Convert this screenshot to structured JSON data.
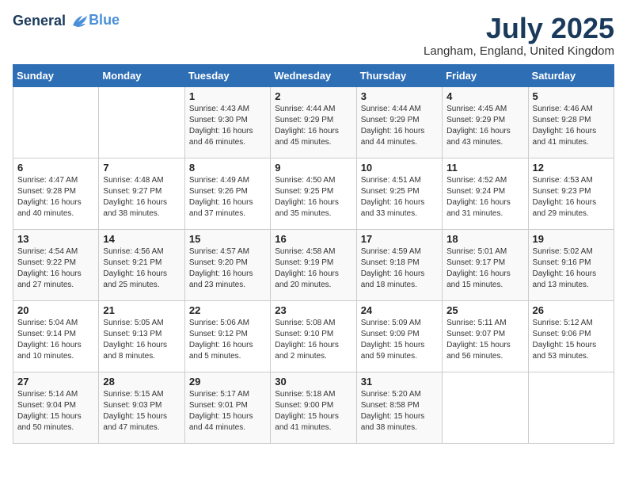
{
  "header": {
    "logo_line1": "General",
    "logo_line2": "Blue",
    "month": "July 2025",
    "location": "Langham, England, United Kingdom"
  },
  "days_of_week": [
    "Sunday",
    "Monday",
    "Tuesday",
    "Wednesday",
    "Thursday",
    "Friday",
    "Saturday"
  ],
  "weeks": [
    [
      {
        "day": "",
        "sunrise": "",
        "sunset": "",
        "daylight": ""
      },
      {
        "day": "",
        "sunrise": "",
        "sunset": "",
        "daylight": ""
      },
      {
        "day": "1",
        "sunrise": "Sunrise: 4:43 AM",
        "sunset": "Sunset: 9:30 PM",
        "daylight": "Daylight: 16 hours and 46 minutes."
      },
      {
        "day": "2",
        "sunrise": "Sunrise: 4:44 AM",
        "sunset": "Sunset: 9:29 PM",
        "daylight": "Daylight: 16 hours and 45 minutes."
      },
      {
        "day": "3",
        "sunrise": "Sunrise: 4:44 AM",
        "sunset": "Sunset: 9:29 PM",
        "daylight": "Daylight: 16 hours and 44 minutes."
      },
      {
        "day": "4",
        "sunrise": "Sunrise: 4:45 AM",
        "sunset": "Sunset: 9:29 PM",
        "daylight": "Daylight: 16 hours and 43 minutes."
      },
      {
        "day": "5",
        "sunrise": "Sunrise: 4:46 AM",
        "sunset": "Sunset: 9:28 PM",
        "daylight": "Daylight: 16 hours and 41 minutes."
      }
    ],
    [
      {
        "day": "6",
        "sunrise": "Sunrise: 4:47 AM",
        "sunset": "Sunset: 9:28 PM",
        "daylight": "Daylight: 16 hours and 40 minutes."
      },
      {
        "day": "7",
        "sunrise": "Sunrise: 4:48 AM",
        "sunset": "Sunset: 9:27 PM",
        "daylight": "Daylight: 16 hours and 38 minutes."
      },
      {
        "day": "8",
        "sunrise": "Sunrise: 4:49 AM",
        "sunset": "Sunset: 9:26 PM",
        "daylight": "Daylight: 16 hours and 37 minutes."
      },
      {
        "day": "9",
        "sunrise": "Sunrise: 4:50 AM",
        "sunset": "Sunset: 9:25 PM",
        "daylight": "Daylight: 16 hours and 35 minutes."
      },
      {
        "day": "10",
        "sunrise": "Sunrise: 4:51 AM",
        "sunset": "Sunset: 9:25 PM",
        "daylight": "Daylight: 16 hours and 33 minutes."
      },
      {
        "day": "11",
        "sunrise": "Sunrise: 4:52 AM",
        "sunset": "Sunset: 9:24 PM",
        "daylight": "Daylight: 16 hours and 31 minutes."
      },
      {
        "day": "12",
        "sunrise": "Sunrise: 4:53 AM",
        "sunset": "Sunset: 9:23 PM",
        "daylight": "Daylight: 16 hours and 29 minutes."
      }
    ],
    [
      {
        "day": "13",
        "sunrise": "Sunrise: 4:54 AM",
        "sunset": "Sunset: 9:22 PM",
        "daylight": "Daylight: 16 hours and 27 minutes."
      },
      {
        "day": "14",
        "sunrise": "Sunrise: 4:56 AM",
        "sunset": "Sunset: 9:21 PM",
        "daylight": "Daylight: 16 hours and 25 minutes."
      },
      {
        "day": "15",
        "sunrise": "Sunrise: 4:57 AM",
        "sunset": "Sunset: 9:20 PM",
        "daylight": "Daylight: 16 hours and 23 minutes."
      },
      {
        "day": "16",
        "sunrise": "Sunrise: 4:58 AM",
        "sunset": "Sunset: 9:19 PM",
        "daylight": "Daylight: 16 hours and 20 minutes."
      },
      {
        "day": "17",
        "sunrise": "Sunrise: 4:59 AM",
        "sunset": "Sunset: 9:18 PM",
        "daylight": "Daylight: 16 hours and 18 minutes."
      },
      {
        "day": "18",
        "sunrise": "Sunrise: 5:01 AM",
        "sunset": "Sunset: 9:17 PM",
        "daylight": "Daylight: 16 hours and 15 minutes."
      },
      {
        "day": "19",
        "sunrise": "Sunrise: 5:02 AM",
        "sunset": "Sunset: 9:16 PM",
        "daylight": "Daylight: 16 hours and 13 minutes."
      }
    ],
    [
      {
        "day": "20",
        "sunrise": "Sunrise: 5:04 AM",
        "sunset": "Sunset: 9:14 PM",
        "daylight": "Daylight: 16 hours and 10 minutes."
      },
      {
        "day": "21",
        "sunrise": "Sunrise: 5:05 AM",
        "sunset": "Sunset: 9:13 PM",
        "daylight": "Daylight: 16 hours and 8 minutes."
      },
      {
        "day": "22",
        "sunrise": "Sunrise: 5:06 AM",
        "sunset": "Sunset: 9:12 PM",
        "daylight": "Daylight: 16 hours and 5 minutes."
      },
      {
        "day": "23",
        "sunrise": "Sunrise: 5:08 AM",
        "sunset": "Sunset: 9:10 PM",
        "daylight": "Daylight: 16 hours and 2 minutes."
      },
      {
        "day": "24",
        "sunrise": "Sunrise: 5:09 AM",
        "sunset": "Sunset: 9:09 PM",
        "daylight": "Daylight: 15 hours and 59 minutes."
      },
      {
        "day": "25",
        "sunrise": "Sunrise: 5:11 AM",
        "sunset": "Sunset: 9:07 PM",
        "daylight": "Daylight: 15 hours and 56 minutes."
      },
      {
        "day": "26",
        "sunrise": "Sunrise: 5:12 AM",
        "sunset": "Sunset: 9:06 PM",
        "daylight": "Daylight: 15 hours and 53 minutes."
      }
    ],
    [
      {
        "day": "27",
        "sunrise": "Sunrise: 5:14 AM",
        "sunset": "Sunset: 9:04 PM",
        "daylight": "Daylight: 15 hours and 50 minutes."
      },
      {
        "day": "28",
        "sunrise": "Sunrise: 5:15 AM",
        "sunset": "Sunset: 9:03 PM",
        "daylight": "Daylight: 15 hours and 47 minutes."
      },
      {
        "day": "29",
        "sunrise": "Sunrise: 5:17 AM",
        "sunset": "Sunset: 9:01 PM",
        "daylight": "Daylight: 15 hours and 44 minutes."
      },
      {
        "day": "30",
        "sunrise": "Sunrise: 5:18 AM",
        "sunset": "Sunset: 9:00 PM",
        "daylight": "Daylight: 15 hours and 41 minutes."
      },
      {
        "day": "31",
        "sunrise": "Sunrise: 5:20 AM",
        "sunset": "Sunset: 8:58 PM",
        "daylight": "Daylight: 15 hours and 38 minutes."
      },
      {
        "day": "",
        "sunrise": "",
        "sunset": "",
        "daylight": ""
      },
      {
        "day": "",
        "sunrise": "",
        "sunset": "",
        "daylight": ""
      }
    ]
  ]
}
